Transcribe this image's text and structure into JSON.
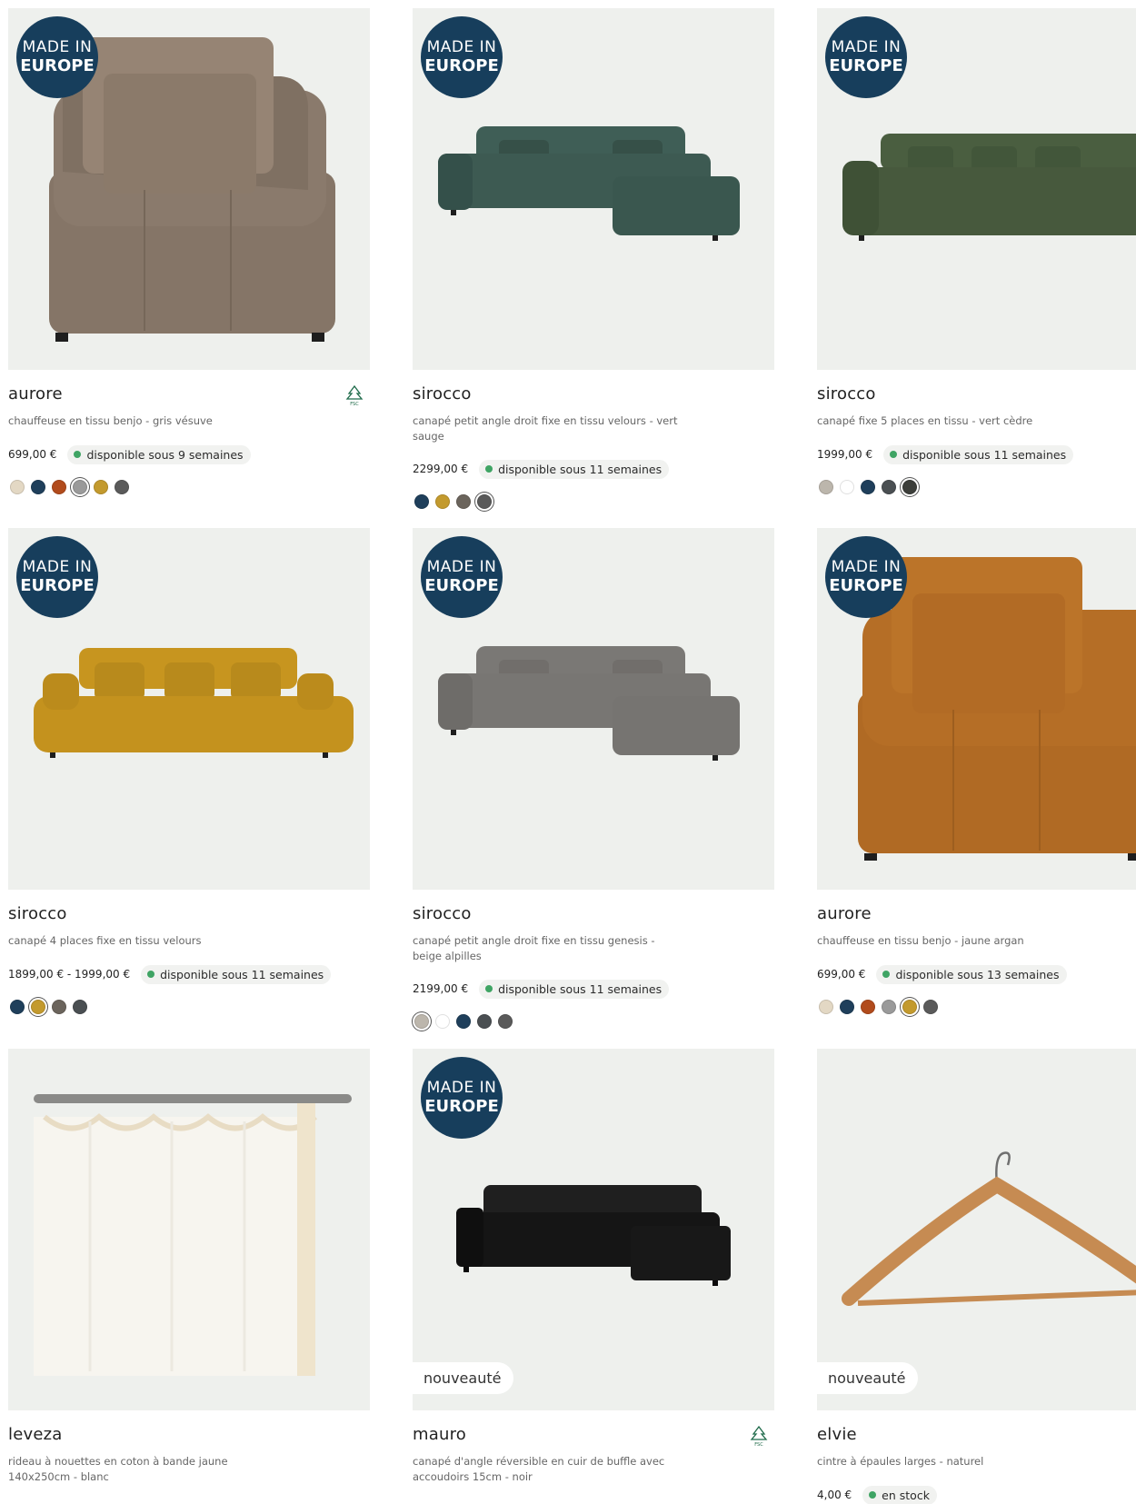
{
  "badge": {
    "made_in_l1": "MADE IN",
    "made_in_l2": "EUROPE",
    "new_label": "nouveauté"
  },
  "colors": {
    "badge_bg": "#173e5c",
    "available_dot": "#3fa464",
    "image_bg": "#eef0ed"
  },
  "products": [
    {
      "name": "aurore",
      "description": "chauffeuse en tissu benjo - gris vésuve",
      "price": "699,00 €",
      "availability": "disponible sous 9 semaines",
      "made_in_europe": true,
      "fsc": true,
      "image": "chair-icon",
      "swatches": [
        "#e3d8c4",
        "#1f3f5b",
        "#b14b1c",
        "#9a9a9a",
        "#c39a2e",
        "#5a5a5a"
      ],
      "selected_swatch": 3
    },
    {
      "name": "sirocco",
      "description": "canapé petit angle droit fixe en tissu velours - vert sauge",
      "price": "2299,00 €",
      "availability": "disponible sous 11 semaines",
      "made_in_europe": true,
      "fsc": false,
      "image": "sofa-corner-icon",
      "swatches": [
        "#1f3f5b",
        "#c39a2e",
        "#6b645c",
        "#5a5a5a"
      ],
      "selected_swatch": 3
    },
    {
      "name": "sirocco",
      "description": "canapé fixe 5 places en tissu - vert cèdre",
      "price": "1999,00 €",
      "availability": "disponible sous 11 semaines",
      "made_in_europe": true,
      "fsc": false,
      "image": "sofa-icon",
      "swatches": [
        "#bcb6ac",
        "#ffffff",
        "#1f3f5b",
        "#4a4f52",
        "#3c3e3a"
      ],
      "selected_swatch": 4
    },
    {
      "name": "sirocco",
      "description": "canapé 4 places fixe en tissu velours",
      "price": "1899,00 € - 1999,00 €",
      "availability": "disponible sous 11 semaines",
      "made_in_europe": true,
      "fsc": false,
      "image": "sofa-icon",
      "swatches": [
        "#1f3f5b",
        "#c39a2e",
        "#6b645c",
        "#4a4f52"
      ],
      "selected_swatch": 1
    },
    {
      "name": "sirocco",
      "description": "canapé petit angle droit fixe en tissu genesis - beige alpilles",
      "price": "2199,00 €",
      "availability": "disponible sous 11 semaines",
      "made_in_europe": true,
      "fsc": false,
      "image": "sofa-corner-icon",
      "swatches": [
        "#bcb6ac",
        "#ffffff",
        "#1f3f5b",
        "#4a4f52",
        "#5a5a5a"
      ],
      "selected_swatch": 0
    },
    {
      "name": "aurore",
      "description": "chauffeuse en tissu benjo - jaune argan",
      "price": "699,00 €",
      "availability": "disponible sous 13 semaines",
      "made_in_europe": true,
      "fsc": false,
      "image": "chair-icon",
      "swatches": [
        "#e3d8c4",
        "#1f3f5b",
        "#b14b1c",
        "#9a9a9a",
        "#c39a2e",
        "#5a5a5a"
      ],
      "selected_swatch": 4
    },
    {
      "name": "leveza",
      "description": "rideau à nouettes en coton à bande jaune 140x250cm - blanc",
      "price": "",
      "availability": "",
      "made_in_europe": false,
      "fsc": false,
      "image": "curtain-icon",
      "swatches": [],
      "selected_swatch": -1
    },
    {
      "name": "mauro",
      "description": "canapé d'angle réversible en cuir de buffle avec accoudoirs 15cm - noir",
      "price": "",
      "availability": "",
      "made_in_europe": true,
      "fsc": true,
      "new": true,
      "image": "sofa-corner-icon",
      "swatches": [],
      "selected_swatch": -1
    },
    {
      "name": "elvie",
      "description": "cintre à épaules larges - naturel",
      "price": "4,00 €",
      "availability": "en stock",
      "made_in_europe": false,
      "fsc": false,
      "new": true,
      "image": "hanger-icon",
      "swatches": [],
      "selected_swatch": -1
    }
  ]
}
